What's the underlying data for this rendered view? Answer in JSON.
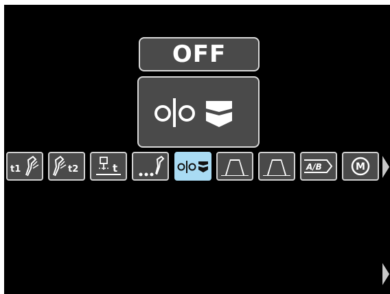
{
  "display": {
    "value": "OFF",
    "selected_mode_icon": "2-step-trigger-icon"
  },
  "toolbar": {
    "items": [
      {
        "label": "t1",
        "icon": "preflow-time-icon"
      },
      {
        "label": "t2",
        "icon": "postflow-time-icon"
      },
      {
        "label": "t",
        "icon": "spot-timer-icon"
      },
      {
        "label": "",
        "icon": "run-in-wfs-icon"
      },
      {
        "label": "",
        "icon": "trigger-2step-4step-icon",
        "selected": true
      },
      {
        "label": "",
        "icon": "start-procedure-icon"
      },
      {
        "label": "",
        "icon": "end-procedure-icon"
      },
      {
        "label": "A/B",
        "icon": "ab-procedure-icon"
      },
      {
        "label": "M",
        "icon": "memory-icon"
      }
    ]
  },
  "colors": {
    "background": "#000000",
    "panel": "#4a4a4a",
    "border": "#d8d8d8",
    "selected": "#a9dbf3"
  }
}
